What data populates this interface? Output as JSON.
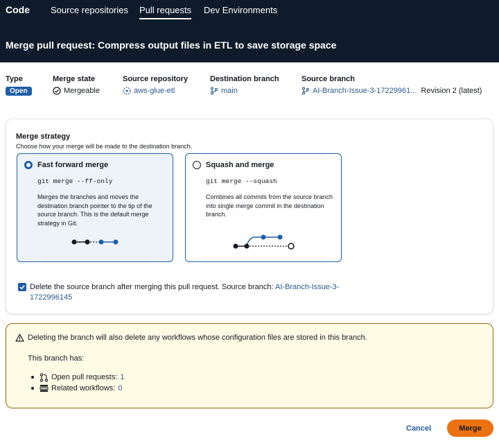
{
  "nav": {
    "brand": "Code",
    "tabs": [
      "Source repositories",
      "Pull requests",
      "Dev Environments"
    ],
    "active_tab": "Pull requests"
  },
  "page": {
    "title": "Merge pull request: Compress output files in ETL to save storage space"
  },
  "info": {
    "type_label": "Type",
    "type_value": "Open",
    "merge_state_label": "Merge state",
    "merge_state_value": "Mergeable",
    "source_repo_label": "Source repository",
    "source_repo_value": "aws-glue-etl",
    "dest_branch_label": "Destination branch",
    "dest_branch_value": "main",
    "source_branch_label": "Source branch",
    "source_branch_value": "AI-Branch-Issue-3-17229961...",
    "revision": "Revision 2 (latest)"
  },
  "strategy": {
    "title": "Merge strategy",
    "description": "Choose how your merge will be made to the destination branch.",
    "options": [
      {
        "title": "Fast forward merge",
        "code": "git merge --ff-only",
        "description": "Merges the branches and moves the destination branch pointer to the tip of the source branch. This is the default merge strategy in Git.",
        "selected": true
      },
      {
        "title": "Squash and merge",
        "code": "git merge --squash",
        "description": "Combines all commits from the source branch into single merge commit in the destination branch.",
        "selected": false
      }
    ],
    "delete_checkbox_text": "Delete the source branch after merging this pull request. Source branch: ",
    "delete_checkbox_branch": "AI-Branch-Issue-3-1722996145",
    "delete_checked": true
  },
  "warning": {
    "text": "Deleting the branch will also delete any workflows whose configuration files are stored in this branch.",
    "has_label": "This branch has:",
    "open_prs_label": "Open pull requests: ",
    "open_prs_value": "1",
    "workflows_label": "Related workflows: ",
    "workflows_value": "0"
  },
  "footer": {
    "cancel_label": "Cancel",
    "merge_label": "Merge"
  },
  "colors": {
    "nav_bg": "#0f1b2a",
    "accent": "#1f5ea8",
    "primary_button": "#ec7211",
    "warning_bg": "#fffce6"
  }
}
